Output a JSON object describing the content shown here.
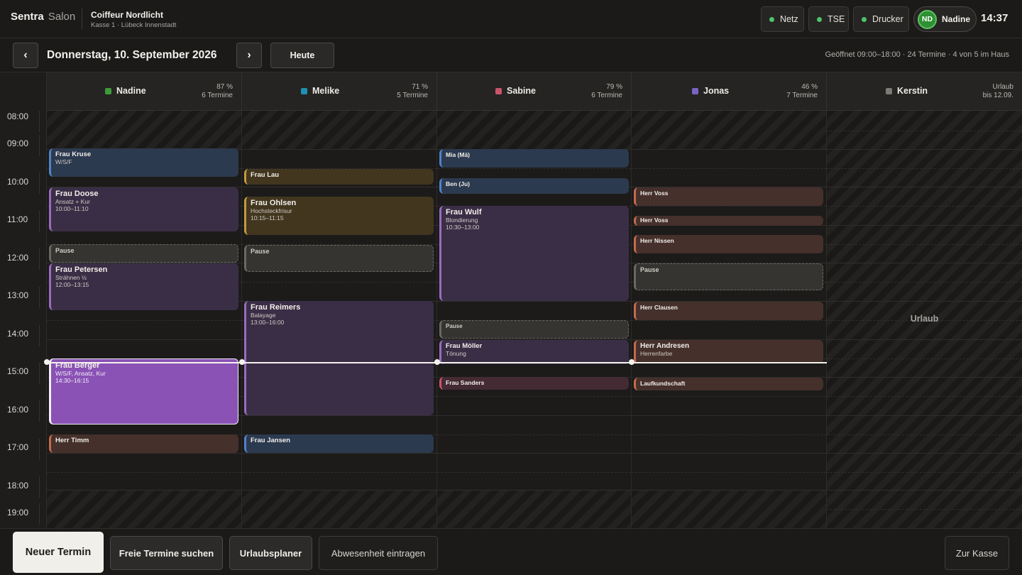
{
  "header": {
    "brand": "Sentra",
    "brand_suffix": "Salon",
    "store_name": "Coiffeur Nordlicht",
    "store_sub": "Kasse 1 · Lübeck Innenstadt",
    "status": [
      {
        "label": "Netz",
        "color": "#4fc36a"
      },
      {
        "label": "TSE",
        "color": "#4fc36a"
      },
      {
        "label": "Drucker",
        "color": "#4fc36a"
      }
    ],
    "user_initials": "ND",
    "user_name": "Nadine",
    "clock": "14:37"
  },
  "datebar": {
    "prev_icon": "‹",
    "next_icon": "›",
    "date": "Donnerstag, 10. September 2026",
    "today_label": "Heute",
    "info": "Geöffnet 09:00–18:00 · 24 Termine · 4 von 5 im Haus"
  },
  "times": [
    "08:00",
    "09:00",
    "10:00",
    "11:00",
    "12:00",
    "13:00",
    "14:00",
    "15:00",
    "16:00",
    "17:00",
    "18:00",
    "19:00"
  ],
  "staff": [
    {
      "name": "Nadine",
      "color": "#3f9a3a",
      "util": "87 %",
      "count": "6 Termine"
    },
    {
      "name": "Melike",
      "color": "#1f8fb3",
      "util": "71 %",
      "count": "5 Termine"
    },
    {
      "name": "Sabine",
      "color": "#c9556b",
      "util": "79 %",
      "count": "6 Termine"
    },
    {
      "name": "Jonas",
      "color": "#7a63c4",
      "util": "46 %",
      "count": "7 Termine"
    },
    {
      "name": "Kerstin",
      "color": "#7d7b77",
      "util": "Urlaub",
      "count": "bis 12.09."
    }
  ],
  "absence_label": "Urlaub",
  "appointments": {
    "nadine": [
      {
        "title": "Frau Kruse",
        "sub": "W/S/F"
      },
      {
        "title": "Frau Doose",
        "sub": "Ansatz + Kur",
        "time": "10:00–11:10"
      },
      {
        "title": "Pause"
      },
      {
        "title": "Frau Petersen",
        "sub": "Strähnen ½",
        "time": "12:00–13:15"
      },
      {
        "title": "Frau Berger",
        "sub": "W/S/F, Ansatz, Kur",
        "time": "14:30–16:15"
      },
      {
        "title": "Herr Timm"
      }
    ],
    "melike": [
      {
        "title": "Frau Lau"
      },
      {
        "title": "Frau Ohlsen",
        "sub": "Hochsteckfrisur",
        "time": "10:15–11:15"
      },
      {
        "title": "Pause"
      },
      {
        "title": "Frau Reimers",
        "sub": "Balayage",
        "time": "13:00–16:00"
      },
      {
        "title": "Frau Jansen"
      }
    ],
    "sabine": [
      {
        "title": "Mia (Mä)"
      },
      {
        "title": "Ben (Ju)"
      },
      {
        "title": "Frau Wulf",
        "sub": "Blondierung",
        "time": "10:30–13:00"
      },
      {
        "title": "Pause"
      },
      {
        "title": "Frau Möller",
        "sub": "Tönung"
      },
      {
        "title": "Frau Sanders"
      }
    ],
    "jonas": [
      {
        "title": "Herr Voss"
      },
      {
        "title": "Herr Voss"
      },
      {
        "title": "Herr Nissen"
      },
      {
        "title": "Pause"
      },
      {
        "title": "Herr Clausen"
      },
      {
        "title": "Herr Andresen",
        "sub": "Herrenfarbe"
      },
      {
        "title": "Laufkundschaft"
      }
    ]
  },
  "footer": {
    "new_appointment": "Neuer Termin",
    "find_free": "Freie Termine suchen",
    "vacation_planner": "Urlaubsplaner",
    "enter_absence": "Abwesenheit eintragen",
    "checkout": "Zur Kasse"
  }
}
